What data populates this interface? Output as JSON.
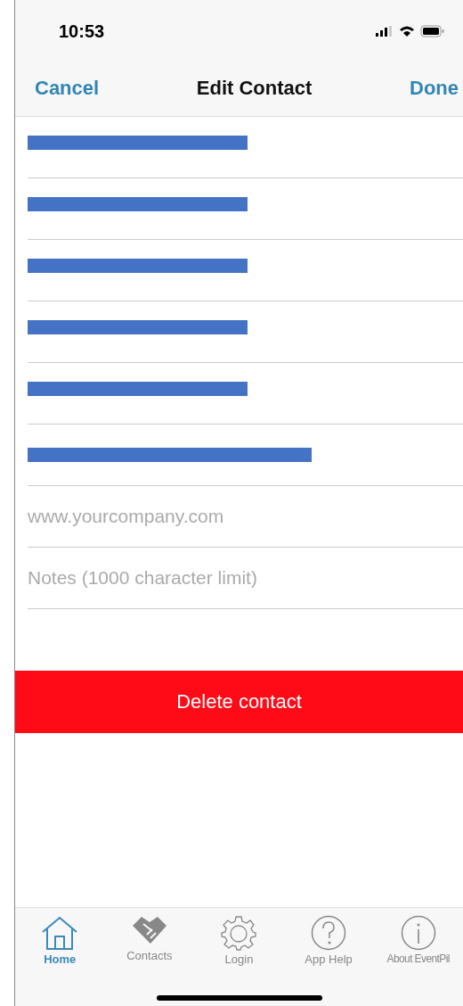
{
  "status_bar": {
    "time": "10:53"
  },
  "nav": {
    "cancel": "Cancel",
    "title": "Edit Contact",
    "done": "Done"
  },
  "fields": [
    {
      "kind": "redacted"
    },
    {
      "kind": "redacted"
    },
    {
      "kind": "redacted"
    },
    {
      "kind": "redacted"
    },
    {
      "kind": "redacted"
    },
    {
      "kind": "redacted_long"
    },
    {
      "kind": "input",
      "placeholder": "www.yourcompany.com"
    },
    {
      "kind": "input",
      "placeholder": "Notes (1000 character limit)"
    }
  ],
  "delete_button": "Delete contact",
  "tabs": [
    {
      "label": "Home",
      "kind": "home",
      "selected": true
    },
    {
      "label": "Contacts",
      "kind": "handshake",
      "selected": false
    },
    {
      "label": "Login",
      "kind": "gear",
      "selected": false
    },
    {
      "label": "App Help",
      "kind": "help",
      "selected": false
    },
    {
      "label": "About EventPil",
      "kind": "info",
      "selected": false
    }
  ]
}
